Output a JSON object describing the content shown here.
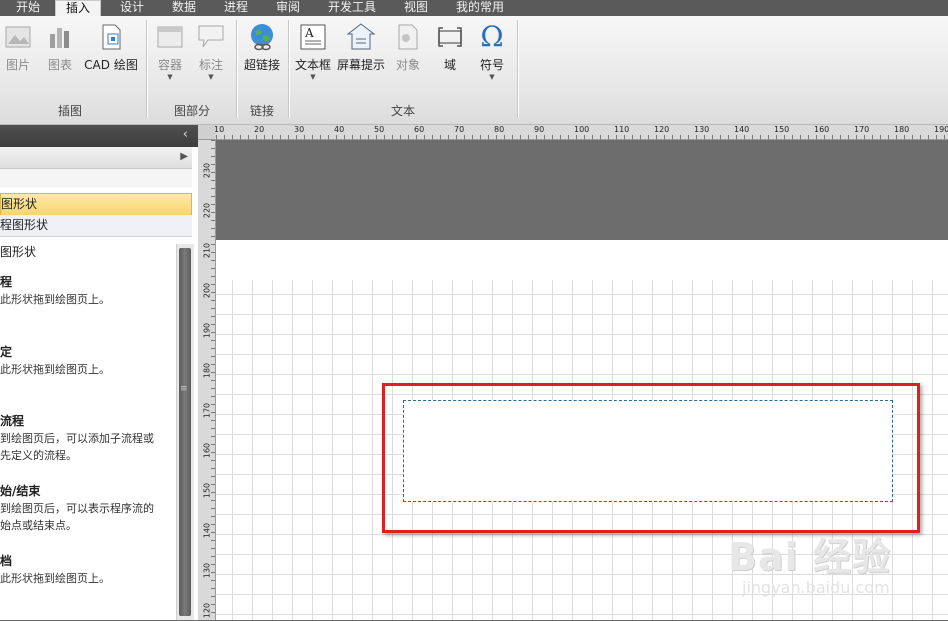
{
  "ribbon_tabs": [
    "开始",
    "插入",
    "设计",
    "数据",
    "进程",
    "审阅",
    "开发工具",
    "视图",
    "我的常用"
  ],
  "active_tab": "插入",
  "ribbon": {
    "picture": "图片",
    "chart": "图表",
    "cad": "CAD 绘图",
    "container": "容器",
    "callout": "标注",
    "hyperlink": "超链接",
    "textbox": "文本框",
    "screentip": "屏幕提示",
    "object": "对象",
    "field": "域",
    "symbol": "符号",
    "symbol_glyph": "Ω",
    "group_illustrations": "插图",
    "group_diagram_parts": "图部分",
    "group_links": "链接",
    "group_text": "文本"
  },
  "pane": {
    "collapse": "‹",
    "row_a_label": "",
    "row_b_label": "",
    "row_c_label": "图形状",
    "row_d_label": "程图形状",
    "section_title": "图形状",
    "items": [
      {
        "name": "程",
        "desc": "此形状拖到绘图页上。"
      },
      {
        "name": "定",
        "desc": "此形状拖到绘图页上。"
      },
      {
        "name": "流程",
        "desc": "到绘图页后，可以添加子流程或\n先定义的流程。"
      },
      {
        "name": "始/结束",
        "desc": "到绘图页后，可以表示程序流的\n始点或结束点。"
      },
      {
        "name": "档",
        "desc": "此形状拖到绘图页上。"
      }
    ]
  },
  "ruler_top": [
    "10",
    "20",
    "30",
    "40",
    "50",
    "60",
    "70",
    "80",
    "90",
    "100",
    "110",
    "120",
    "130",
    "140",
    "150",
    "160",
    "170",
    "180",
    "190"
  ],
  "ruler_left": [
    "230",
    "220",
    "210",
    "200",
    "190",
    "180",
    "170",
    "160",
    "150",
    "140",
    "130",
    "120"
  ],
  "watermark": "Bai  经验",
  "watermark_sub": "jingyan.baidu.com",
  "colors": {
    "highlight": "#e02020",
    "selection_border": "#2a6a9a"
  }
}
